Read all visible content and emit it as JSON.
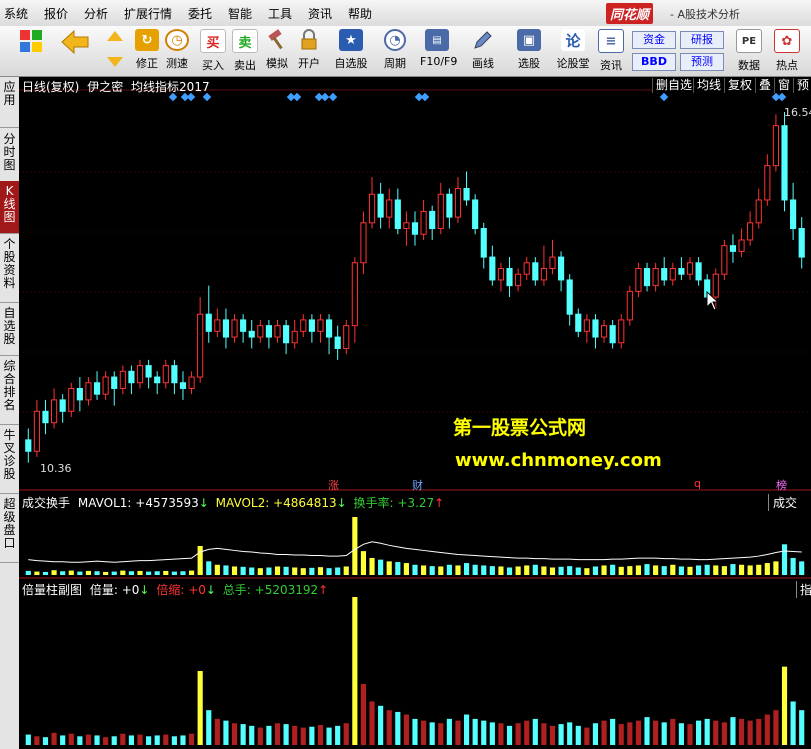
{
  "menu": {
    "items": [
      "系统",
      "报价",
      "分析",
      "扩展行情",
      "委托",
      "智能",
      "工具",
      "资讯",
      "帮助"
    ],
    "brand": "同花顺",
    "brand_sub": "- A股技术分析"
  },
  "toolbar": {
    "buttons": [
      {
        "label": "修正",
        "icon": "refresh-icon",
        "color": "#e6a100"
      },
      {
        "label": "测速",
        "icon": "clock-icon",
        "color": "#d08000"
      },
      {
        "label": "买入",
        "icon": "buy-icon",
        "color": "#d22"
      },
      {
        "label": "卖出",
        "icon": "sell-icon",
        "color": "#2a2"
      },
      {
        "label": "模拟",
        "icon": "hammer-icon",
        "color": "#b55"
      },
      {
        "label": "开户",
        "icon": "lock-icon",
        "color": "#888"
      },
      {
        "label": "自选股",
        "icon": "star-icon",
        "color": "#2a5db0"
      },
      {
        "label": "周期",
        "icon": "period-icon",
        "color": "#4a6aa8"
      },
      {
        "label": "F10/F9",
        "icon": "f10-icon",
        "color": "#4a6aa8"
      },
      {
        "label": "画线",
        "icon": "pencil-icon",
        "color": "#4a6aa8"
      },
      {
        "label": "选股",
        "icon": "monitor-icon",
        "color": "#4a6aa8"
      },
      {
        "label": "论股堂",
        "icon": "lun-icon",
        "color": "#2a5db0"
      },
      {
        "label": "资讯",
        "icon": "doc-icon",
        "color": "#4a6aa8"
      },
      {
        "label": "数据",
        "icon": "pe-icon",
        "color": "#888"
      },
      {
        "label": "热点",
        "icon": "hot-icon",
        "color": "#c33"
      }
    ],
    "sq": [
      "资金",
      "研报",
      "BBD",
      "预测"
    ],
    "tb_letters": [
      "买",
      "卖",
      "论",
      "PE"
    ]
  },
  "left_tabs": [
    "应用",
    "分时图",
    "K线图",
    "个股资料",
    "自选股",
    "综合排名",
    "牛叉诊股",
    "超级盘口"
  ],
  "chart": {
    "title": "日线(复权)",
    "indicator_name": "伊之密",
    "indicator": "均线指标2017",
    "right_buttons": [
      "删自选",
      "均线",
      "复权",
      "叠",
      "窗",
      "预",
      ""
    ],
    "price_high": "16.54",
    "price_low": "10.36",
    "watermark_cn": "第一股票公式网",
    "watermark_url": "www.chnmoney.com",
    "events": [
      {
        "t": "涨",
        "c": "#ff4444"
      },
      {
        "t": "财",
        "c": "#6fa8ff"
      },
      {
        "t": "q",
        "c": "#ff3333"
      },
      {
        "t": "榜",
        "c": "#ff66ff"
      }
    ]
  },
  "volume_panel": {
    "name": "成交换手",
    "ma1_label": "MAVOL1:",
    "ma1_value": "+4573593",
    "ma2_label": "MAVOL2:",
    "ma2_value": "+4864813",
    "turn_label": "换手率:",
    "turn_value": "+3.27",
    "right_tab": "成交"
  },
  "bottom_panel": {
    "name": "倍量柱副图",
    "b1_label": "倍量:",
    "b1_value": "+0",
    "b2_label": "倍缩:",
    "b2_value": "+0",
    "b3_label": "总手:",
    "b3_value": "+5203192",
    "right_tab": "指"
  },
  "colors": {
    "up": "#ff3232",
    "down": "#54ffff",
    "ma1": "#ffffff",
    "vol_yellow": "#ffff3a",
    "diamond": "#3f9fff"
  },
  "chart_data": {
    "type": "candlestick",
    "series": [
      {
        "name": "K线",
        "values": [
          [
            10.8,
            10.6,
            11.0,
            10.4
          ],
          [
            10.6,
            11.3,
            11.5,
            10.5
          ],
          [
            11.3,
            11.1,
            11.5,
            10.9
          ],
          [
            11.1,
            11.5,
            11.7,
            11.0
          ],
          [
            11.5,
            11.3,
            11.6,
            11.1
          ],
          [
            11.3,
            11.7,
            11.8,
            11.2
          ],
          [
            11.7,
            11.5,
            11.9,
            11.3
          ],
          [
            11.5,
            11.8,
            11.9,
            11.4
          ],
          [
            11.8,
            11.6,
            12.0,
            11.5
          ],
          [
            11.6,
            11.9,
            12.0,
            11.5
          ],
          [
            11.9,
            11.7,
            12.0,
            11.4
          ],
          [
            11.7,
            12.0,
            12.1,
            11.6
          ],
          [
            12.0,
            11.8,
            12.1,
            11.6
          ],
          [
            11.8,
            12.1,
            12.2,
            11.7
          ],
          [
            12.1,
            11.9,
            12.2,
            11.7
          ],
          [
            11.9,
            11.8,
            12.0,
            11.6
          ],
          [
            11.8,
            12.1,
            12.2,
            11.7
          ],
          [
            12.1,
            11.8,
            12.2,
            11.6
          ],
          [
            11.8,
            11.7,
            12.0,
            11.5
          ],
          [
            11.7,
            11.9,
            12.0,
            11.6
          ],
          [
            11.9,
            13.0,
            13.3,
            11.8
          ],
          [
            13.0,
            12.7,
            13.5,
            12.5
          ],
          [
            12.7,
            12.9,
            13.1,
            12.6
          ],
          [
            12.9,
            12.6,
            13.1,
            12.4
          ],
          [
            12.6,
            12.9,
            13.0,
            12.5
          ],
          [
            12.9,
            12.7,
            13.0,
            12.5
          ],
          [
            12.7,
            12.6,
            12.9,
            12.4
          ],
          [
            12.6,
            12.8,
            12.9,
            12.5
          ],
          [
            12.8,
            12.6,
            12.9,
            12.4
          ],
          [
            12.6,
            12.8,
            12.9,
            12.5
          ],
          [
            12.8,
            12.5,
            12.9,
            12.3
          ],
          [
            12.5,
            12.7,
            12.9,
            12.4
          ],
          [
            12.7,
            12.9,
            13.0,
            12.6
          ],
          [
            12.9,
            12.7,
            13.0,
            12.5
          ],
          [
            12.7,
            12.9,
            13.0,
            12.5
          ],
          [
            12.9,
            12.6,
            13.0,
            12.3
          ],
          [
            12.6,
            12.4,
            12.8,
            12.2
          ],
          [
            12.4,
            12.8,
            12.9,
            12.3
          ],
          [
            12.8,
            13.9,
            14.0,
            12.5
          ],
          [
            13.9,
            14.6,
            14.8,
            13.7
          ],
          [
            14.6,
            15.1,
            15.4,
            14.5
          ],
          [
            15.1,
            14.7,
            15.3,
            14.5
          ],
          [
            14.7,
            15.0,
            15.2,
            14.5
          ],
          [
            15.0,
            14.5,
            15.2,
            14.4
          ],
          [
            14.5,
            14.6,
            14.8,
            14.2
          ],
          [
            14.6,
            14.4,
            14.8,
            14.2
          ],
          [
            14.4,
            14.8,
            15.0,
            14.3
          ],
          [
            14.8,
            14.5,
            14.9,
            14.3
          ],
          [
            14.5,
            15.1,
            15.3,
            14.4
          ],
          [
            15.1,
            14.7,
            15.2,
            14.5
          ],
          [
            14.7,
            15.2,
            15.4,
            14.6
          ],
          [
            15.2,
            15.0,
            15.5,
            14.9
          ],
          [
            15.0,
            14.5,
            15.1,
            14.4
          ],
          [
            14.5,
            14.0,
            14.6,
            13.8
          ],
          [
            14.0,
            13.6,
            14.2,
            13.5
          ],
          [
            13.6,
            13.8,
            13.9,
            13.4
          ],
          [
            13.8,
            13.5,
            14.0,
            13.3
          ],
          [
            13.5,
            13.7,
            13.8,
            13.4
          ],
          [
            13.7,
            13.9,
            14.0,
            13.6
          ],
          [
            13.9,
            13.6,
            14.0,
            13.5
          ],
          [
            13.6,
            13.8,
            14.2,
            13.5
          ],
          [
            13.8,
            14.0,
            14.3,
            13.7
          ],
          [
            14.0,
            13.6,
            14.1,
            13.4
          ],
          [
            13.6,
            13.0,
            13.7,
            12.8
          ],
          [
            13.0,
            12.7,
            13.1,
            12.6
          ],
          [
            12.7,
            12.9,
            13.0,
            12.5
          ],
          [
            12.9,
            12.6,
            13.0,
            12.4
          ],
          [
            12.6,
            12.8,
            12.9,
            12.5
          ],
          [
            12.8,
            12.5,
            12.9,
            12.4
          ],
          [
            12.5,
            12.9,
            13.0,
            12.4
          ],
          [
            12.9,
            13.4,
            13.5,
            12.8
          ],
          [
            13.4,
            13.8,
            13.9,
            13.3
          ],
          [
            13.8,
            13.5,
            13.9,
            13.4
          ],
          [
            13.5,
            13.8,
            13.9,
            13.4
          ],
          [
            13.8,
            13.6,
            14.0,
            13.5
          ],
          [
            13.6,
            13.8,
            13.9,
            13.5
          ],
          [
            13.8,
            13.7,
            14.0,
            13.6
          ],
          [
            13.7,
            13.9,
            14.0,
            13.6
          ],
          [
            13.9,
            13.6,
            14.0,
            13.5
          ],
          [
            13.6,
            13.3,
            13.7,
            13.2
          ],
          [
            13.3,
            13.7,
            13.8,
            13.1
          ],
          [
            13.7,
            14.2,
            14.3,
            13.6
          ],
          [
            14.2,
            14.1,
            14.4,
            13.9
          ],
          [
            14.1,
            14.3,
            14.5,
            14.0
          ],
          [
            14.3,
            14.6,
            14.8,
            14.2
          ],
          [
            14.6,
            15.0,
            15.2,
            14.5
          ],
          [
            15.0,
            15.6,
            15.8,
            14.9
          ],
          [
            15.6,
            16.3,
            16.5,
            15.5
          ],
          [
            16.3,
            15.0,
            16.54,
            14.8
          ],
          [
            15.0,
            14.5,
            15.3,
            14.3
          ],
          [
            14.5,
            14.0,
            14.7,
            13.8
          ]
        ]
      },
      {
        "name": "MAVOL1",
        "values": [
          30,
          28,
          27,
          26,
          26,
          25,
          25,
          26,
          27,
          26,
          25,
          26,
          27,
          28,
          28,
          29,
          30,
          31,
          32,
          33,
          45,
          50,
          52,
          50,
          48,
          46,
          45,
          43,
          42,
          40,
          40,
          39,
          39,
          38,
          38,
          37,
          37,
          38,
          50,
          60,
          65,
          62,
          58,
          55,
          52,
          50,
          48,
          46,
          44,
          42,
          40,
          39,
          38,
          37,
          36,
          35,
          34,
          33,
          33,
          32,
          32,
          31,
          31,
          31,
          30,
          30,
          30,
          30,
          31,
          31,
          32,
          33,
          33,
          33,
          32,
          32,
          31,
          31,
          30,
          30,
          31,
          32,
          33,
          34,
          35,
          37,
          40,
          44,
          47,
          46,
          45
        ]
      },
      {
        "name": "倍量",
        "values": [
          12,
          10,
          9,
          14,
          11,
          13,
          10,
          12,
          11,
          9,
          10,
          13,
          11,
          12,
          10,
          11,
          12,
          10,
          11,
          13,
          85,
          40,
          30,
          28,
          25,
          24,
          22,
          20,
          22,
          25,
          24,
          22,
          20,
          21,
          23,
          20,
          22,
          25,
          170,
          70,
          50,
          45,
          40,
          38,
          35,
          30,
          28,
          26,
          25,
          30,
          28,
          35,
          30,
          28,
          26,
          25,
          22,
          25,
          28,
          30,
          25,
          22,
          24,
          26,
          22,
          20,
          25,
          28,
          30,
          24,
          26,
          28,
          32,
          28,
          26,
          30,
          25,
          24,
          28,
          30,
          28,
          26,
          32,
          30,
          28,
          30,
          35,
          40,
          90,
          50,
          40
        ]
      }
    ]
  }
}
